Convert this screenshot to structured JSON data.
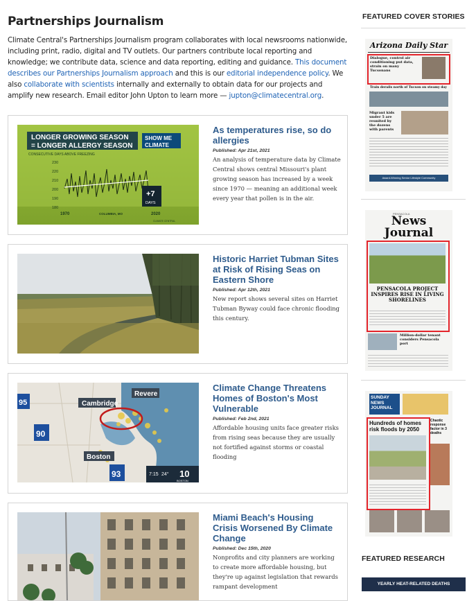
{
  "page": {
    "title": "Partnerships Journalism",
    "intro": {
      "part1": "Climate Central's Partnerships Journalism program collaborates with local newsrooms nationwide, including print, radio, digital and TV outlets. Our partners contribute local reporting and knowledge; we contribute data, science and data reporting, editing and guidance. ",
      "link1": "This document describes our Partnerships Journalism approach",
      "part2": " and this is our ",
      "link2": "editorial independence policy",
      "part3": ". We also ",
      "link3": "collaborate with scientists",
      "part4": " internally and externally to obtain data for our projects and amplify new research. Email editor John Upton to learn more — ",
      "link4": "jupton@climatecentral.org",
      "part5": "."
    }
  },
  "articles": [
    {
      "title": "As temperatures rise, so do allergies",
      "published": "Published: Apr 21st, 2021",
      "desc": "An analysis of temperature data by Climate Central shows central Missouri's plant growing season has increased by a week since 1970 — meaning an additional week every year that pollen is in the air.",
      "thumb": {
        "head1": "LONGER GROWING SEASON",
        "head2": "= LONGER ALLERGY SEASON",
        "badge1": "SHOW ME",
        "badge2": "CLIMATE",
        "sub": "CONSECUTIVE DAYS ABOVE FREEZING",
        "yticks": [
          "230",
          "220",
          "210",
          "200",
          "190",
          "180",
          "170"
        ],
        "x_start": "1970",
        "x_end": "2020",
        "place": "COLUMBIA, MO",
        "delta": "+7",
        "delta_unit": "DAYS",
        "logo": "CLIMATE CENTRAL"
      }
    },
    {
      "title": "Historic Harriet Tubman Sites at Risk of Rising Seas on Eastern Shore",
      "published": "Published: Apr 12th, 2021",
      "desc": "New report shows several sites on Harriet Tubman Byway could face chronic flooding this century."
    },
    {
      "title": "Climate Change Threatens Homes of Boston's Most Vulnerable",
      "published": "Published: Feb 2nd, 2021",
      "desc": "Affordable housing units face greater risks from rising seas because they are usually not fortified against storms or coastal flooding",
      "thumb": {
        "city1": "Cambridge",
        "city2": "Revere",
        "city3": "Boston",
        "hw1": "95",
        "hw2": "90",
        "hw3": "93",
        "time": "7:15",
        "temp": "24°",
        "channel": "10",
        "channel_sub": "BOSTON"
      }
    },
    {
      "title": "Miami Beach's Housing Crisis Worsened By Climate Change",
      "published": "Published: Dec 15th, 2020",
      "desc": "Nonprofits and city planners are working to create more affordable housing, but they're up against legislation that rewards rampant development"
    }
  ],
  "sidebar": {
    "featured_covers": "FEATURED COVER STORIES",
    "covers": [
      {
        "masthead": "Arizona Daily Star",
        "headline": "Dialogue, control air conditioning put data, strain on many Tucsonans",
        "sub": "Train derails north of Tucson on steamy day",
        "left_head": "Migrant kids under 5 are reunited by the dozens with parents",
        "ad": "Award-Winning Senior Lifestyle Community"
      },
      {
        "masthead": "News Journal",
        "masthead_small": "PENSACOLA",
        "headline": "PENSACOLA PROJECT INSPIRES RISE IN LIVING SHORELINES",
        "sub": "Million-dollar tenant considers Pensacola port"
      },
      {
        "masthead": "SUNDAY NEWS JOURNAL",
        "headline": "Hundreds of homes risk floods by 2050",
        "side_head": "Chaotic response factor in 3 deaths"
      }
    ],
    "featured_research": "FEATURED RESEARCH",
    "research_banner": "YEARLY HEAT-RELATED DEATHS"
  },
  "colors": {
    "link": "#1f63b5",
    "title": "#2e5b8c",
    "highlight": "#e3242b"
  }
}
